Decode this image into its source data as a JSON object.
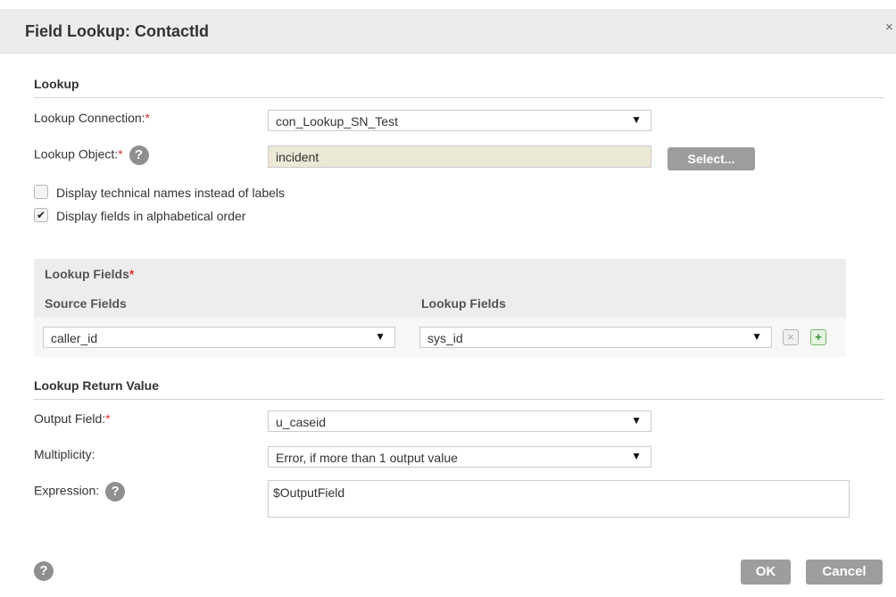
{
  "dialog": {
    "title": "Field Lookup: ContactId",
    "close_label": "×"
  },
  "lookup_section": {
    "title": "Lookup",
    "connection_label": "Lookup Connection:",
    "connection_value": "con_Lookup_SN_Test",
    "object_label": "Lookup Object:",
    "object_value": "incident",
    "select_button": "Select...",
    "checkbox_technical": {
      "label": "Display technical names instead of labels",
      "checked": false
    },
    "checkbox_alpha": {
      "label": "Display fields in alphabetical order",
      "checked": true
    }
  },
  "lookup_fields": {
    "title": "Lookup Fields",
    "source_header": "Source Fields",
    "lookup_header": "Lookup Fields",
    "rows": [
      {
        "source": "caller_id",
        "lookup": "sys_id"
      }
    ]
  },
  "return_section": {
    "title": "Lookup Return Value",
    "output_label": "Output Field:",
    "output_value": "u_caseid",
    "multiplicity_label": "Multiplicity:",
    "multiplicity_value": "Error, if more than 1 output value",
    "expression_label": "Expression:",
    "expression_value": "$OutputField"
  },
  "footer": {
    "ok_button": "OK",
    "cancel_button": "Cancel"
  },
  "common": {
    "required_mark": "*",
    "help_glyph": "?",
    "dropdown_glyph": "▼",
    "check_glyph": "✔",
    "remove_glyph": "×",
    "add_glyph": "+"
  }
}
